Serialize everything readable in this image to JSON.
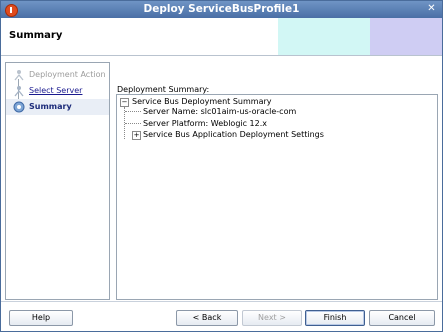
{
  "window": {
    "title": "Deploy ServiceBusProfile1",
    "close_glyph": "✕",
    "icons": [
      "app-icon",
      "close-icon"
    ]
  },
  "header": {
    "title": "Summary"
  },
  "nav": {
    "steps": [
      {
        "label": "Deployment Action",
        "state": "visited",
        "icon": "step-person-icon"
      },
      {
        "label": "Select Server",
        "state": "link",
        "icon": "step-person-icon"
      },
      {
        "label": "Summary",
        "state": "current",
        "icon": "step-current-icon"
      }
    ]
  },
  "content": {
    "label": "Deployment Summary:",
    "tree": {
      "root": "Service Bus Deployment Summary",
      "root_toggle": "−",
      "children": [
        {
          "label": "Server Name: slc01aim-us-oracle-com"
        },
        {
          "label": "Server Platform: Weblogic 12.x"
        },
        {
          "label": "Service Bus Application Deployment Settings",
          "toggle": "+"
        }
      ]
    }
  },
  "buttons": {
    "help": "Help",
    "back": "< Back",
    "next": "Next >",
    "finish": "Finish",
    "cancel": "Cancel"
  },
  "colors": {
    "title_bar": "#5a7fb5",
    "header_band_1": "#d2f7f5",
    "header_band_2": "#cfcdf3",
    "current_step_bg": "#e9eef6",
    "link": "#1a1a8f"
  }
}
